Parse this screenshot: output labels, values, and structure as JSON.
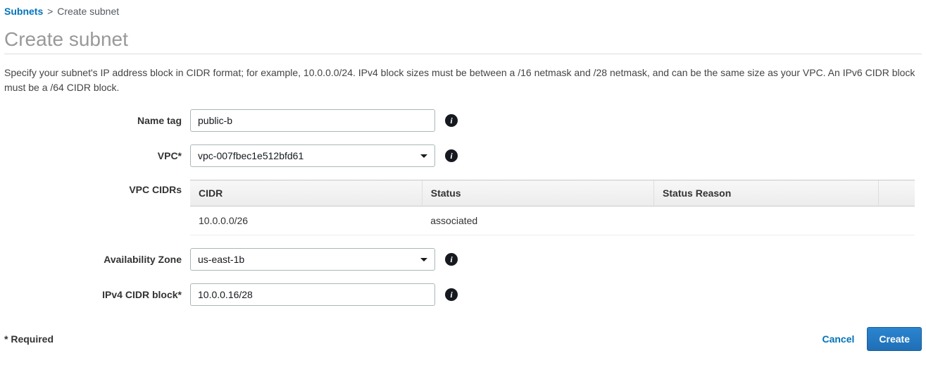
{
  "breadcrumb": {
    "parent": "Subnets",
    "current": "Create subnet"
  },
  "page_title": "Create subnet",
  "description": "Specify your subnet's IP address block in CIDR format; for example, 10.0.0.0/24. IPv4 block sizes must be between a /16 netmask and /28 netmask, and can be the same size as your VPC. An IPv6 CIDR block must be a /64 CIDR block.",
  "form": {
    "name_tag": {
      "label": "Name tag",
      "value": "public-b"
    },
    "vpc": {
      "label": "VPC*",
      "value": "vpc-007fbec1e512bfd61"
    },
    "vpc_cidrs": {
      "label": "VPC CIDRs",
      "headers": {
        "cidr": "CIDR",
        "status": "Status",
        "reason": "Status Reason"
      },
      "rows": [
        {
          "cidr": "10.0.0.0/26",
          "status": "associated",
          "reason": ""
        }
      ]
    },
    "az": {
      "label": "Availability Zone",
      "value": "us-east-1b"
    },
    "ipv4_cidr": {
      "label": "IPv4 CIDR block*",
      "value": "10.0.0.16/28"
    }
  },
  "footer": {
    "required_note": "* Required",
    "cancel": "Cancel",
    "create": "Create"
  }
}
